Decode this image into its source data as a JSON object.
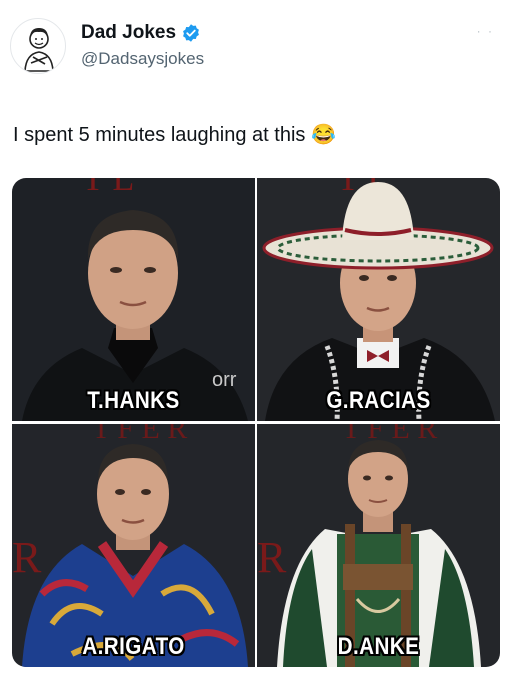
{
  "post": {
    "display_name": "Dad Jokes",
    "handle": "@Dadsaysjokes",
    "verified": true,
    "text": "I spent 5 minutes laughing at this 😂",
    "more_icon": "more-dots-icon",
    "accent": "#1d9bf0"
  },
  "media": {
    "panels": [
      {
        "caption": "T.HANKS",
        "outfit": "black suit"
      },
      {
        "caption": "G.RACIAS",
        "outfit": "sombrero and charro jacket"
      },
      {
        "caption": "A.RIGATO",
        "outfit": "blue kimono"
      },
      {
        "caption": "D.ANKE",
        "outfit": "green lederhosen"
      }
    ]
  }
}
